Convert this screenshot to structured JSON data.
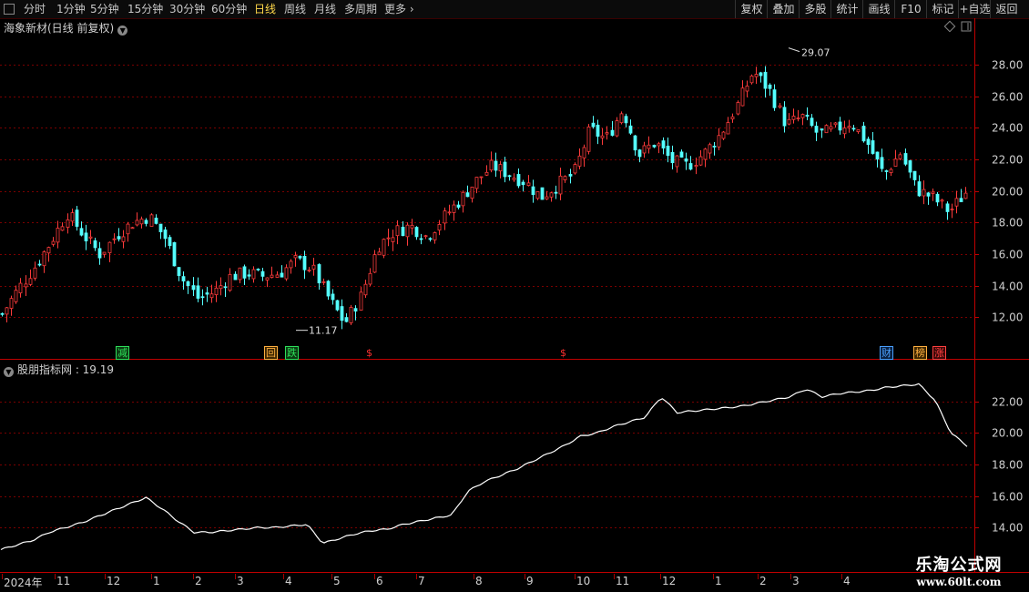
{
  "toolbar": {
    "periods": [
      "分时",
      "1分钟",
      "5分钟",
      "15分钟",
      "30分钟",
      "60分钟",
      "日线",
      "周线",
      "月线",
      "多周期",
      "更多 ›"
    ],
    "active": "日线",
    "actions": [
      "复权",
      "叠加",
      "多股",
      "统计",
      "画线",
      "F10",
      "标记",
      "+自选",
      "返回"
    ]
  },
  "main_panel": {
    "title": "海象新材(日线 前复权)",
    "high_label": "29.07",
    "low_label": "11.17",
    "event_markers": [
      {
        "text": "减",
        "color": "#2ee05a",
        "bg": "#0b3b12"
      },
      {
        "text": "回",
        "color": "#ffb040",
        "bg": "#3b2500"
      },
      {
        "text": "跌",
        "color": "#2ee05a",
        "bg": "#0b3b12"
      },
      {
        "text": "$",
        "color": "#ff3030",
        "bg": "transparent"
      },
      {
        "text": "$",
        "color": "#ff3030",
        "bg": "transparent"
      },
      {
        "text": "财",
        "color": "#4aa0ff",
        "bg": "#0a2040"
      },
      {
        "text": "榜",
        "color": "#ffb040",
        "bg": "#3b2500"
      },
      {
        "text": "涨",
        "color": "#ff4040",
        "bg": "#3b0808"
      }
    ]
  },
  "indicator_panel": {
    "title": "股朋指标网 : 19.19"
  },
  "x_axis": {
    "labels": [
      "2024年",
      "11",
      "12",
      "1",
      "2",
      "3",
      "4",
      "5",
      "6",
      "7",
      "8",
      "9",
      "10",
      "11",
      "12",
      "1",
      "2",
      "3",
      "4"
    ]
  },
  "watermark": {
    "line1": "乐淘公式网",
    "line2": "www.60lt.com"
  },
  "colors": {
    "up": "#ff3b3b",
    "down": "#54ffff",
    "grid": "#7a0000",
    "frame": "#c00000",
    "line": "#ffffff"
  },
  "chart_data": [
    {
      "type": "candlestick",
      "title": "海象新材(日线 前复权)",
      "y_ticks": [
        12.0,
        14.0,
        16.0,
        18.0,
        20.0,
        22.0,
        24.0,
        26.0,
        28.0
      ],
      "ylim": [
        10.4,
        29.8
      ],
      "annotations": [
        {
          "label": "29.07",
          "value": 29.07,
          "kind": "high"
        },
        {
          "label": "11.17",
          "value": 11.17,
          "kind": "low"
        }
      ],
      "trend_close": [
        12.2,
        13.8,
        15.2,
        16.8,
        18.6,
        17.2,
        16.0,
        17.2,
        18.0,
        18.4,
        17.0,
        14.5,
        13.2,
        13.6,
        14.6,
        14.8,
        14.6,
        14.8,
        15.6,
        15.1,
        13.2,
        11.6,
        13.4,
        16.5,
        17.4,
        17.8,
        17.1,
        18.3,
        19.4,
        20.6,
        21.6,
        21.1,
        20.6,
        19.6,
        20.4,
        21.1,
        23.9,
        23.3,
        25.2,
        22.3,
        23.1,
        21.9,
        21.6,
        22.4,
        23.6,
        25.4,
        27.6,
        26.4,
        24.2,
        24.7,
        23.6,
        23.9,
        24.4,
        23.0,
        21.0,
        22.4,
        20.1,
        19.6,
        18.7,
        19.9
      ],
      "grid": true
    },
    {
      "type": "line",
      "series": [
        {
          "name": "股朋指标网",
          "last": 19.19
        }
      ],
      "y_ticks": [
        14.0,
        16.0,
        18.0,
        20.0,
        22.0
      ],
      "ylim": [
        12.8,
        23.9
      ],
      "values": [
        12.6,
        12.9,
        13.2,
        13.7,
        14.0,
        14.3,
        14.7,
        15.1,
        15.5,
        15.9,
        15.2,
        14.4,
        13.7,
        13.7,
        13.8,
        13.9,
        14.0,
        14.0,
        14.1,
        14.2,
        13.0,
        13.3,
        13.6,
        13.8,
        13.9,
        14.2,
        14.4,
        14.6,
        14.8,
        16.3,
        16.9,
        17.3,
        17.7,
        18.2,
        18.7,
        19.2,
        19.8,
        20.0,
        20.4,
        20.7,
        21.0,
        22.3,
        21.3,
        21.4,
        21.5,
        21.6,
        21.7,
        21.9,
        22.1,
        22.3,
        22.8,
        22.3,
        22.5,
        22.6,
        22.7,
        22.9,
        23.0,
        23.1,
        22.1,
        20.0,
        19.19
      ],
      "grid": true
    }
  ]
}
